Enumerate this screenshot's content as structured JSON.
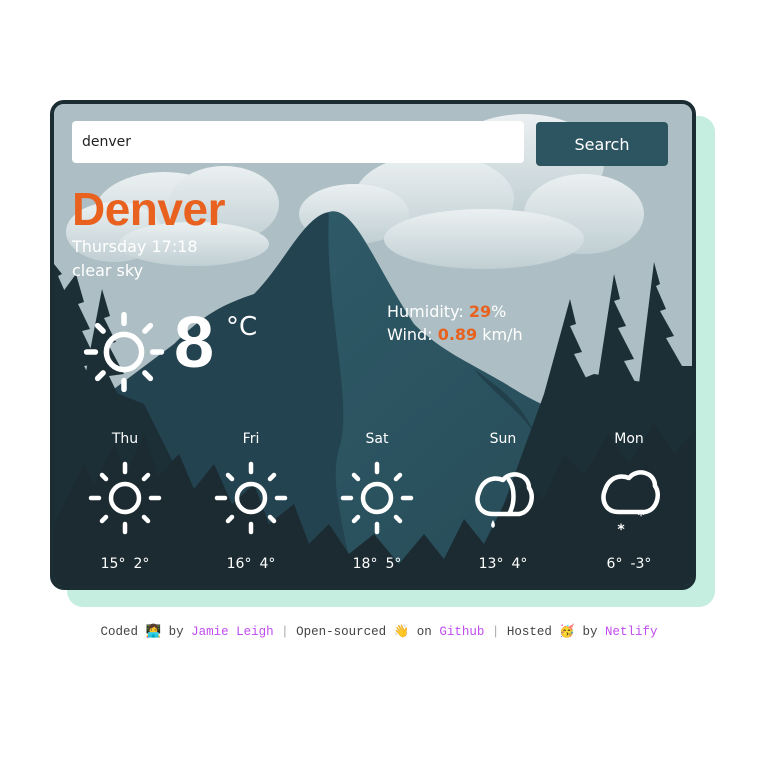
{
  "search": {
    "value": "denver",
    "placeholder": "Enter a city",
    "button_label": "Search"
  },
  "current": {
    "city": "Denver",
    "datetime": "Thursday 17:18",
    "description": "clear sky",
    "icon": "sun-icon",
    "temperature": "8",
    "unit": "°C",
    "humidity_label": "Humidity: ",
    "humidity_value": "29",
    "humidity_unit": "%",
    "wind_label": "Wind: ",
    "wind_value": "0.89",
    "wind_unit": " km/h"
  },
  "forecast": [
    {
      "day": "Thu",
      "icon": "sun-icon",
      "max": "15°",
      "min": "2°"
    },
    {
      "day": "Fri",
      "icon": "sun-icon",
      "max": "16°",
      "min": "4°"
    },
    {
      "day": "Sat",
      "icon": "sun-icon",
      "max": "18°",
      "min": "5°"
    },
    {
      "day": "Sun",
      "icon": "cloud-rain-icon",
      "max": "13°",
      "min": "4°"
    },
    {
      "day": "Mon",
      "icon": "cloud-snow-icon",
      "max": "6°",
      "min": "-3°"
    }
  ],
  "footer": {
    "coded": "Coded",
    "coded_emoji": "👩‍💻",
    "by1": "by",
    "author": "Jamie Leigh",
    "sep1": "|",
    "open_sourced": "Open-sourced",
    "open_emoji": "👋",
    "on": "on",
    "github": "Github",
    "sep2": "|",
    "hosted": "Hosted",
    "hosted_emoji": "🥳",
    "by2": "by",
    "netlify": "Netlify"
  },
  "colors": {
    "accent": "#e8611f",
    "button": "#2d5461",
    "frame": "#1b2c33",
    "shadow": "#c5ede0",
    "link": "#c04cf0"
  }
}
